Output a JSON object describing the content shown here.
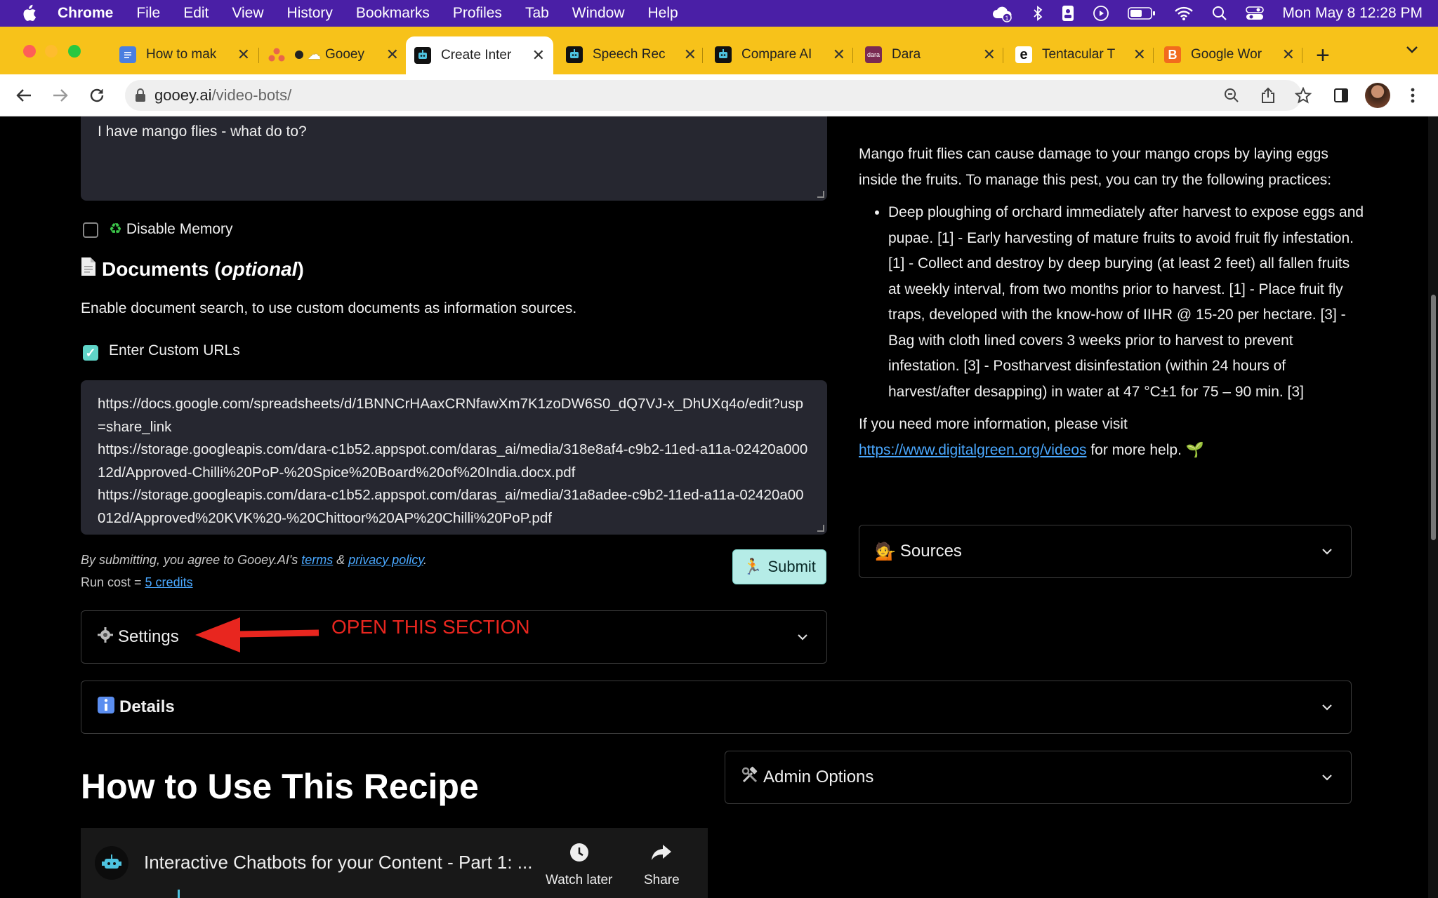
{
  "menubar": {
    "app": "Chrome",
    "items": [
      "File",
      "Edit",
      "View",
      "History",
      "Bookmarks",
      "Profiles",
      "Tab",
      "Window",
      "Help"
    ],
    "clock": "Mon May 8  12:28 PM"
  },
  "tabs": [
    {
      "title": "How to mak",
      "favicon_color": "#4a7fe0",
      "active": false
    },
    {
      "title": "Gooey",
      "favicon_color": "#e8664a",
      "active": false
    },
    {
      "title": "Create Inter",
      "favicon_color": "#111111",
      "active": true
    },
    {
      "title": "Speech Rec",
      "favicon_color": "#111111",
      "active": false
    },
    {
      "title": "Compare AI",
      "favicon_color": "#111111",
      "active": false
    },
    {
      "title": "Dara",
      "favicon_color": "#7a2a52",
      "active": false
    },
    {
      "title": "Tentacular T",
      "favicon_color": "#ffffff",
      "active": false
    },
    {
      "title": "Google Wor",
      "favicon_color": "#f26b1d",
      "active": false
    }
  ],
  "address": {
    "host": "gooey.ai",
    "path": "/video-bots/"
  },
  "form": {
    "question": "I have mango flies - what do to?",
    "disable_memory_label": "Disable Memory",
    "documents_heading": "Documents (",
    "documents_optional": "optional",
    "documents_heading_end": ")",
    "documents_desc": "Enable document search, to use custom documents as information sources.",
    "custom_urls_label": "Enter Custom URLs",
    "urls": [
      "https://docs.google.com/spreadsheets/d/1BNNCrHAaxCRNfawXm7K1zoDW6S0_dQ7VJ-x_DhUXq4o/edit?usp=share_link",
      "https://storage.googleapis.com/dara-c1b52.appspot.com/daras_ai/media/318e8af4-c9b2-11ed-a11a-02420a00012d/Approved-Chilli%20PoP-%20Spice%20Board%20of%20India.docx.pdf",
      "https://storage.googleapis.com/dara-c1b52.appspot.com/daras_ai/media/31a8adee-c9b2-11ed-a11a-02420a00012d/Approved%20KVK%20-%20Chittoor%20AP%20Chilli%20PoP.pdf"
    ],
    "disclaimer_pre": "By submitting, you agree to Gooey.AI's ",
    "terms": "terms",
    "amp": " & ",
    "privacy": "privacy policy",
    "disclaimer_post": ".",
    "run_cost_pre": "Run cost = ",
    "run_cost_link": "5 credits",
    "submit_label": "Submit"
  },
  "sections": {
    "settings": "Settings",
    "details": "Details",
    "admin": "Admin Options",
    "sources": "Sources"
  },
  "annotation": "OPEN THIS SECTION",
  "answer": {
    "intro": "Mango fruit flies can cause damage to your mango crops by laying eggs inside the fruits. To manage this pest, you can try the following practices:",
    "bullet": "Deep ploughing of orchard immediately after harvest to expose eggs and pupae. [1] - Early harvesting of mature fruits to avoid fruit fly infestation. [1] - Collect and destroy by deep burying (at least 2 feet) all fallen fruits at weekly interval, from two months prior to harvest. [1] - Place fruit fly traps, developed with the know-how of IIHR @ 15-20 per hectare. [3] - Bag with cloth lined covers 3 weeks prior to harvest to prevent infestation. [3] - Postharvest disinfestation (within 24 hours of harvest/after desapping) in water at 47 °C±1 for 75 – 90 min. [3]",
    "more_pre": "If you need more information, please visit",
    "more_link": "https://www.digitalgreen.org/videos",
    "more_post": " for more help. 🌱"
  },
  "recipe": {
    "title": "How to Use This Recipe",
    "video_title": "Interactive Chatbots for your Content - Part 1: ...",
    "watch_later": "Watch later",
    "share": "Share"
  }
}
